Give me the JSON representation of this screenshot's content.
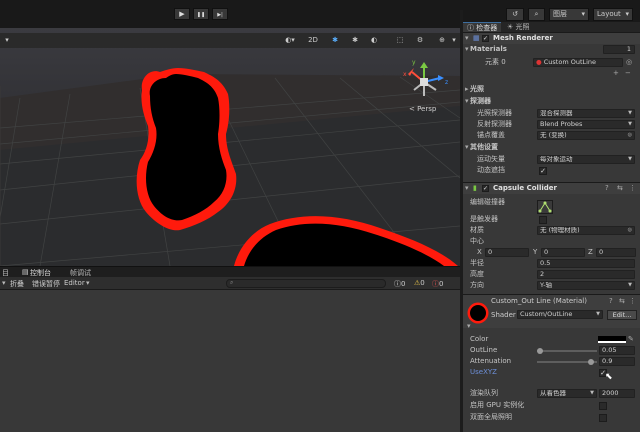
{
  "toolbar": {
    "play_icon": "▶",
    "pause_icon": "❚❚",
    "step_icon": "▶|",
    "layers_label": "图层",
    "layout_label": "Layout"
  },
  "scene": {
    "tools": [
      "2D",
      "✱",
      "✱",
      "◐",
      "⬚",
      "⚙"
    ],
    "persp_label": "< Persp",
    "axis_labels": [
      "y",
      "x",
      "z"
    ]
  },
  "console": {
    "tabs": [
      "目",
      "控制台",
      "帧调试"
    ],
    "tb_items": [
      "折叠",
      "错误暂停",
      "Editor"
    ],
    "count_labels": [
      "0",
      "0",
      "0"
    ]
  },
  "inspector": {
    "tabs": [
      "检查器",
      "光照"
    ],
    "mesh_renderer_title": "Mesh Renderer",
    "materials_label": "Materials",
    "materials_count": "1",
    "element0_label": "元素 0",
    "element0_value": "Custom OutLine",
    "lighting_label": "光照",
    "probes_label": "探测器",
    "light_probes_label": "光照探测器",
    "light_probes_value": "混合探测器",
    "reflection_probes_label": "反射探测器",
    "reflection_probes_value": "Blend Probes",
    "anchor_override_label": "锚点覆盖",
    "anchor_override_value": "无 (变换)",
    "additional_label": "其他设置",
    "motion_vectors_label": "运动矢量",
    "motion_vectors_value": "每对象运动",
    "dynamic_occlusion_label": "动态遮挡",
    "dynamic_occlusion_check": "✓",
    "capsule_title": "Capsule Collider",
    "edit_collider_label": "编辑碰撞器",
    "trigger_label": "是触发器",
    "material_label": "材质",
    "material_value": "无 (物理材质)",
    "center_label": "中心",
    "x_label": "X",
    "x_value": "0",
    "y_label": "Y",
    "y_value": "0",
    "z_label": "Z",
    "z_value": "0",
    "radius_label": "半径",
    "radius_value": "0.5",
    "height_label": "高度",
    "height_value": "2",
    "direction_label": "方向",
    "direction_value": "Y-轴",
    "mat_name": "Custom_Out Line (Material)",
    "shader_label": "Shader",
    "shader_value": "Custom/OutLine",
    "edit_label": "Edit...",
    "color_label": "Color",
    "outline_label": "OutLine",
    "outline_value": "0.05",
    "outline_level": 0.05,
    "attenuation_label": "Attenuation",
    "attenuation_value": "0.9",
    "attenuation_level": 0.9,
    "usexyz_label": "UseXYZ",
    "usexyz_check": "✓",
    "render_queue_label": "渲染队列",
    "render_queue_mode": "从着色器",
    "render_queue_value": "2000",
    "gpu_instancing_label": "启用 GPU 实例化",
    "double_sided_label": "双面全局照明"
  },
  "colors": {
    "outline": "#ff1a0c",
    "accent": "#3d6e9f",
    "link": "#6d8fd8"
  }
}
